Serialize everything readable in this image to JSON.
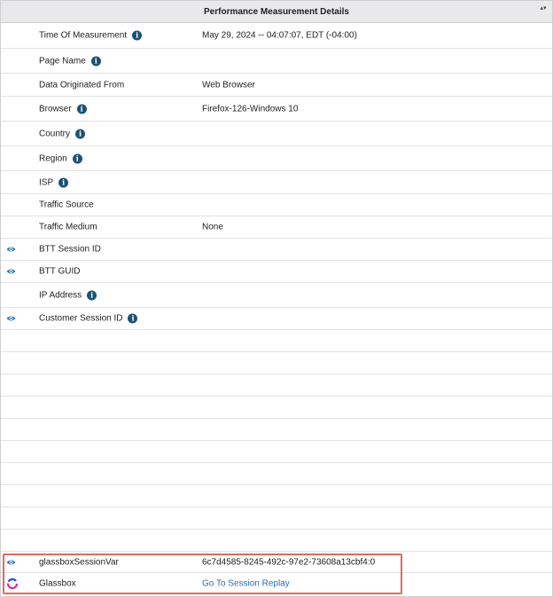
{
  "header": {
    "title": "Performance Measurement Details",
    "sort_glyph": "▴▾"
  },
  "rows": [
    {
      "label": "Time Of Measurement",
      "value": "May 29, 2024 -- 04:07:07, EDT (-04:00)",
      "info": true,
      "eye": false
    },
    {
      "label": "Page Name",
      "value": "",
      "info": true,
      "eye": false
    },
    {
      "label": "Data Originated From",
      "value": "Web Browser",
      "info": false,
      "eye": false
    },
    {
      "label": "Browser",
      "value": "Firefox-126-Windows 10",
      "info": true,
      "eye": false
    },
    {
      "label": "Country",
      "value": "",
      "info": true,
      "eye": false
    },
    {
      "label": "Region",
      "value": "",
      "info": true,
      "eye": false
    },
    {
      "label": "ISP",
      "value": "",
      "info": true,
      "eye": false
    },
    {
      "label": "Traffic Source",
      "value": "",
      "info": false,
      "eye": false
    },
    {
      "label": "Traffic Medium",
      "value": "None",
      "info": false,
      "eye": false
    },
    {
      "label": "BTT Session ID",
      "value": "",
      "info": false,
      "eye": true
    },
    {
      "label": "BTT GUID",
      "value": "",
      "info": false,
      "eye": true
    },
    {
      "label": "IP Address",
      "value": "",
      "info": true,
      "eye": false
    },
    {
      "label": "Customer Session ID",
      "value": "",
      "info": true,
      "eye": true
    }
  ],
  "glassbox_var": {
    "label": "glassboxSessionVar",
    "value": "6c7d4585-8245-492c-97e2-73608a13cbf4:0"
  },
  "glassbox": {
    "label": "Glassbox",
    "link": "Go To Session Replay"
  },
  "colors": {
    "info": "#1a5276",
    "eye": "#2b7bb9",
    "link": "#2b6cb0",
    "highlight": "#e06a5f"
  }
}
